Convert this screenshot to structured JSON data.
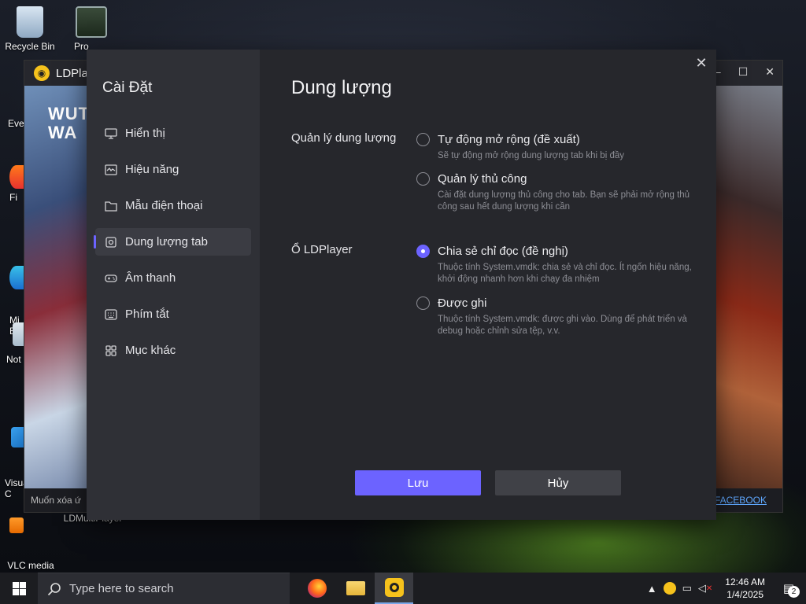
{
  "desktop": {
    "icons": [
      {
        "label": "Recycle Bin"
      },
      {
        "label": "Pro"
      },
      {
        "label": "Eve"
      },
      {
        "label": "Fi"
      },
      {
        "label": "Mi\nE"
      },
      {
        "label": "Not"
      },
      {
        "label": "Visua\nC"
      },
      {
        "label": "VLC media\nplayer"
      },
      {
        "label": "LDMultiPlayer"
      }
    ]
  },
  "ldplayer": {
    "title": "LDPlay",
    "art_text": "WUT\nWA",
    "bottom_left": "Muốn xóa ứ",
    "bottom_right": "FACEBOOK",
    "minimize": "–",
    "maximize": "☐",
    "close": "✕"
  },
  "settings": {
    "title": "Cài Đặt",
    "close_glyph": "✕",
    "nav": [
      {
        "label": "Hiển thị",
        "icon": "monitor-icon"
      },
      {
        "label": "Hiệu năng",
        "icon": "performance-icon"
      },
      {
        "label": "Mẫu điện thoại",
        "icon": "folder-icon"
      },
      {
        "label": "Dung lượng tab",
        "icon": "storage-icon",
        "active": true
      },
      {
        "label": "Âm thanh",
        "icon": "gamepad-icon"
      },
      {
        "label": "Phím tắt",
        "icon": "keyboard-icon"
      },
      {
        "label": "Mục khác",
        "icon": "grid-icon"
      }
    ],
    "page_title": "Dung lượng",
    "sections": [
      {
        "label": "Quản lý dung lượng",
        "options": [
          {
            "label": "Tự động mở rộng (đề xuất)",
            "desc": "Sẽ tự động mở rộng dung lượng tab khi bị đầy",
            "checked": false
          },
          {
            "label": "Quản lý thủ công",
            "desc": "Cài đặt dung lượng thủ công cho tab. Bạn sẽ phải mở rộng thủ công sau hết dung lượng khi cần",
            "checked": false
          }
        ]
      },
      {
        "label": "Ổ LDPlayer",
        "options": [
          {
            "label": "Chia sẻ chỉ đọc (đề nghị)",
            "desc": "Thuộc tính System.vmdk: chia sẻ và chỉ đọc. Ít ngốn hiệu năng, khởi động nhanh hơn khi chạy đa nhiệm",
            "checked": true
          },
          {
            "label": "Được ghi",
            "desc": "Thuộc tính System.vmdk: được ghi vào. Dùng để phát triển và debug hoặc chỉnh sửa tệp, v.v.",
            "checked": false
          }
        ]
      }
    ],
    "save_label": "Lưu",
    "cancel_label": "Hủy",
    "accent_color": "#6c63ff"
  },
  "taskbar": {
    "search_placeholder": "Type here to search",
    "time": "12:46 AM",
    "date": "1/4/2025",
    "notification_count": "2"
  }
}
